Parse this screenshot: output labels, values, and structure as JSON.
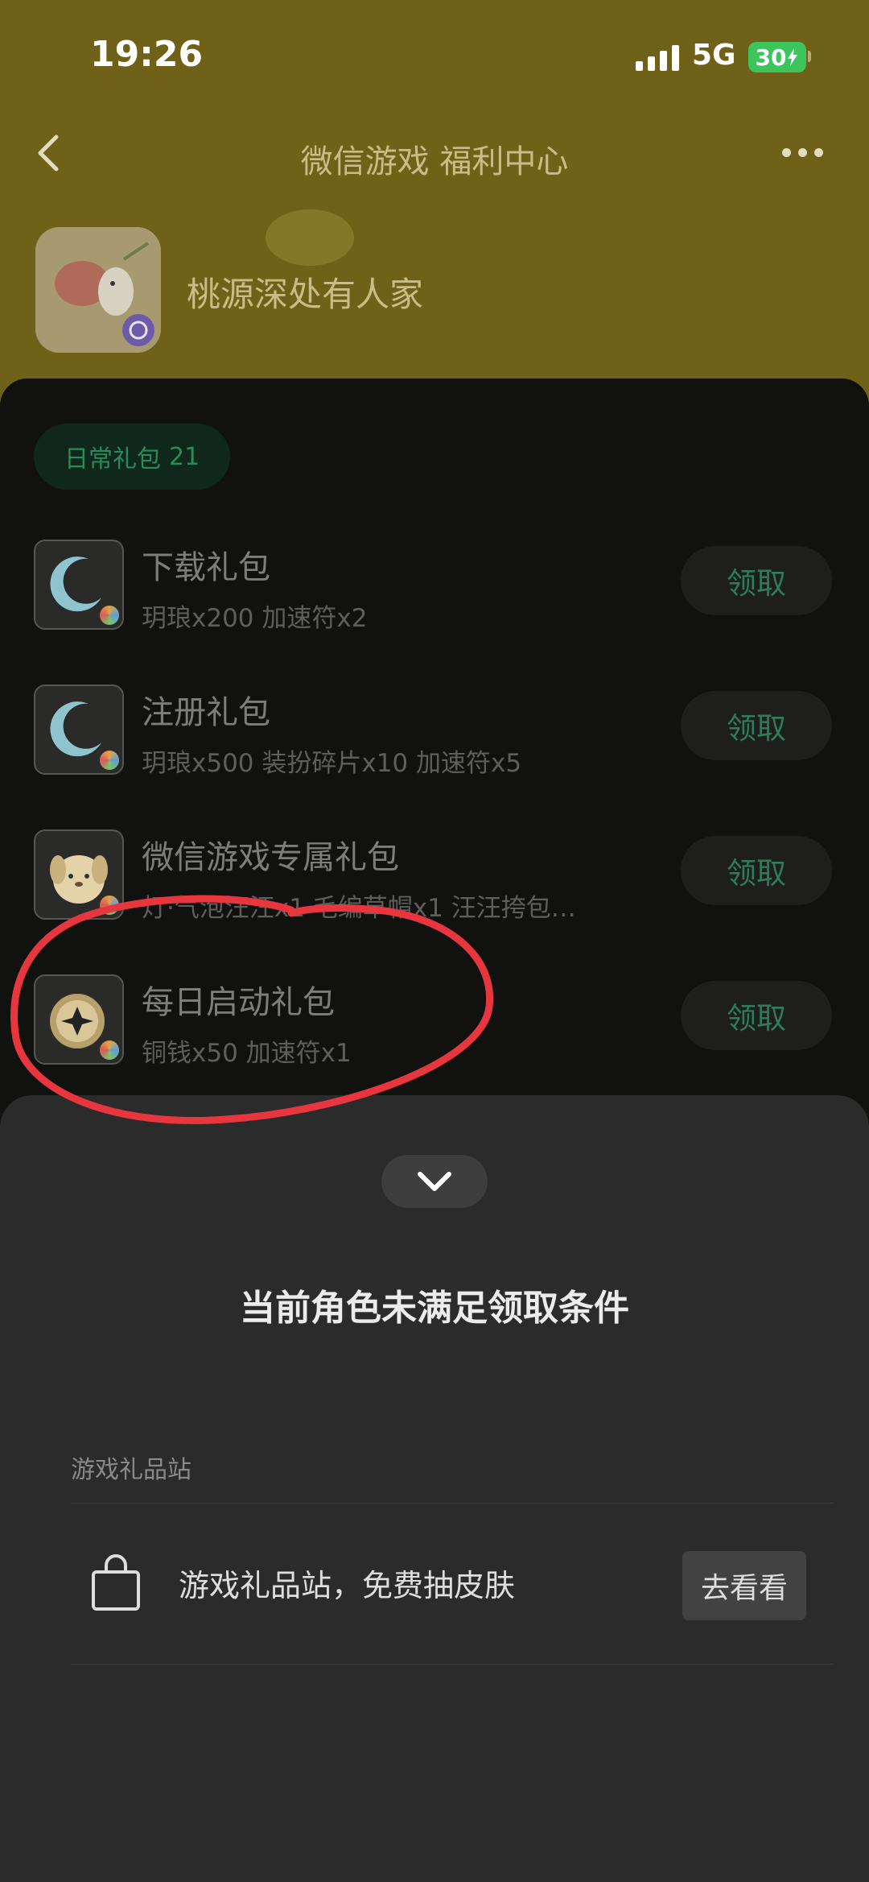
{
  "status_bar": {
    "time": "19:26",
    "network": "5G",
    "battery": "30"
  },
  "nav": {
    "title": "微信游戏 福利中心"
  },
  "game": {
    "name": "桃源深处有人家"
  },
  "tab": {
    "label": "日常礼包",
    "count": "21"
  },
  "gifts": [
    {
      "title": "下载礼包",
      "desc": "玥琅x200 加速符x2",
      "button": "领取",
      "icon": "moon-icon"
    },
    {
      "title": "注册礼包",
      "desc": "玥琅x500 装扮碎片x10 加速符x5",
      "button": "领取",
      "icon": "moon-icon"
    },
    {
      "title": "微信游戏专属礼包",
      "desc": "灯·气泡汪汪x1 毛编草帽x1 汪汪挎包…",
      "button": "领取",
      "icon": "puppy-icon"
    },
    {
      "title": "每日启动礼包",
      "desc": "铜钱x50 加速符x1",
      "button": "领取",
      "icon": "coin-icon"
    }
  ],
  "sheet": {
    "title": "当前角色未满足领取条件",
    "section_label": "游戏礼品站",
    "store_text": "游戏礼品站，免费抽皮肤",
    "goto_button": "去看看"
  },
  "colors": {
    "accent_green": "#2e7d5a",
    "annotation_red": "#e8363f",
    "battery_green": "#3cc45d"
  }
}
